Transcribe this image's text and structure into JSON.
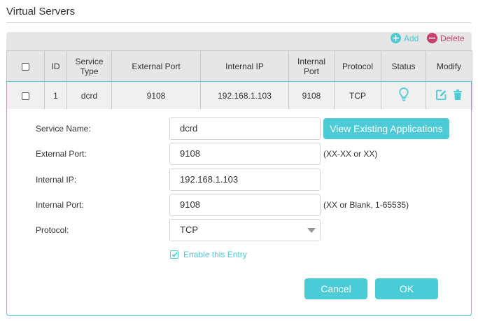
{
  "page": {
    "title": "Virtual Servers"
  },
  "toolbar": {
    "add_label": "Add",
    "delete_label": "Delete"
  },
  "table": {
    "headers": [
      "",
      "ID",
      "Service Type",
      "External Port",
      "Internal IP",
      "Internal Port",
      "Protocol",
      "Status",
      "Modify"
    ],
    "rows": [
      {
        "id": "1",
        "service_type": "dcrd",
        "external_port": "9108",
        "internal_ip": "192.168.1.103",
        "internal_port": "9108",
        "protocol": "TCP",
        "status_icon": "lightbulb-icon"
      }
    ]
  },
  "form": {
    "service_name_label": "Service Name:",
    "service_name_value": "dcrd",
    "view_apps_label": "View Existing Applications",
    "external_port_label": "External Port:",
    "external_port_value": "9108",
    "external_port_hint": "(XX-XX or XX)",
    "internal_ip_label": "Internal IP:",
    "internal_ip_value": "192.168.1.103",
    "internal_port_label": "Internal Port:",
    "internal_port_value": "9108",
    "internal_port_hint": "(XX or Blank, 1-65535)",
    "protocol_label": "Protocol:",
    "protocol_value": "TCP",
    "enable_label": "Enable this Entry",
    "enable_checked": true,
    "cancel_label": "Cancel",
    "ok_label": "OK"
  },
  "colors": {
    "accent": "#4acbd6",
    "delete": "#c73f6d",
    "header_bg": "#e6e6e6"
  }
}
